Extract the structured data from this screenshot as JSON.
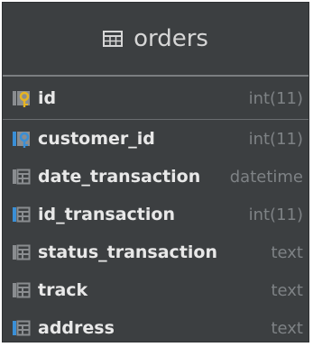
{
  "table": {
    "title": "orders",
    "columns": [
      {
        "name": "id",
        "type": "int(11)",
        "icon": "primary-key-column-icon"
      },
      {
        "name": "customer_id",
        "type": "int(11)",
        "icon": "foreign-key-index-column-icon"
      },
      {
        "name": "date_transaction",
        "type": "datetime",
        "icon": "column-icon"
      },
      {
        "name": "id_transaction",
        "type": "int(11)",
        "icon": "indexed-column-icon"
      },
      {
        "name": "status_transaction",
        "type": "text",
        "icon": "column-icon"
      },
      {
        "name": "track",
        "type": "text",
        "icon": "column-icon"
      },
      {
        "name": "address",
        "type": "text",
        "icon": "indexed-column-icon"
      }
    ]
  },
  "colors": {
    "background": "#3c3f41",
    "column_text": "#e8e8e8",
    "type_text": "#7e8285",
    "key_gold": "#e6b422",
    "index_blue": "#3a8fd6"
  }
}
